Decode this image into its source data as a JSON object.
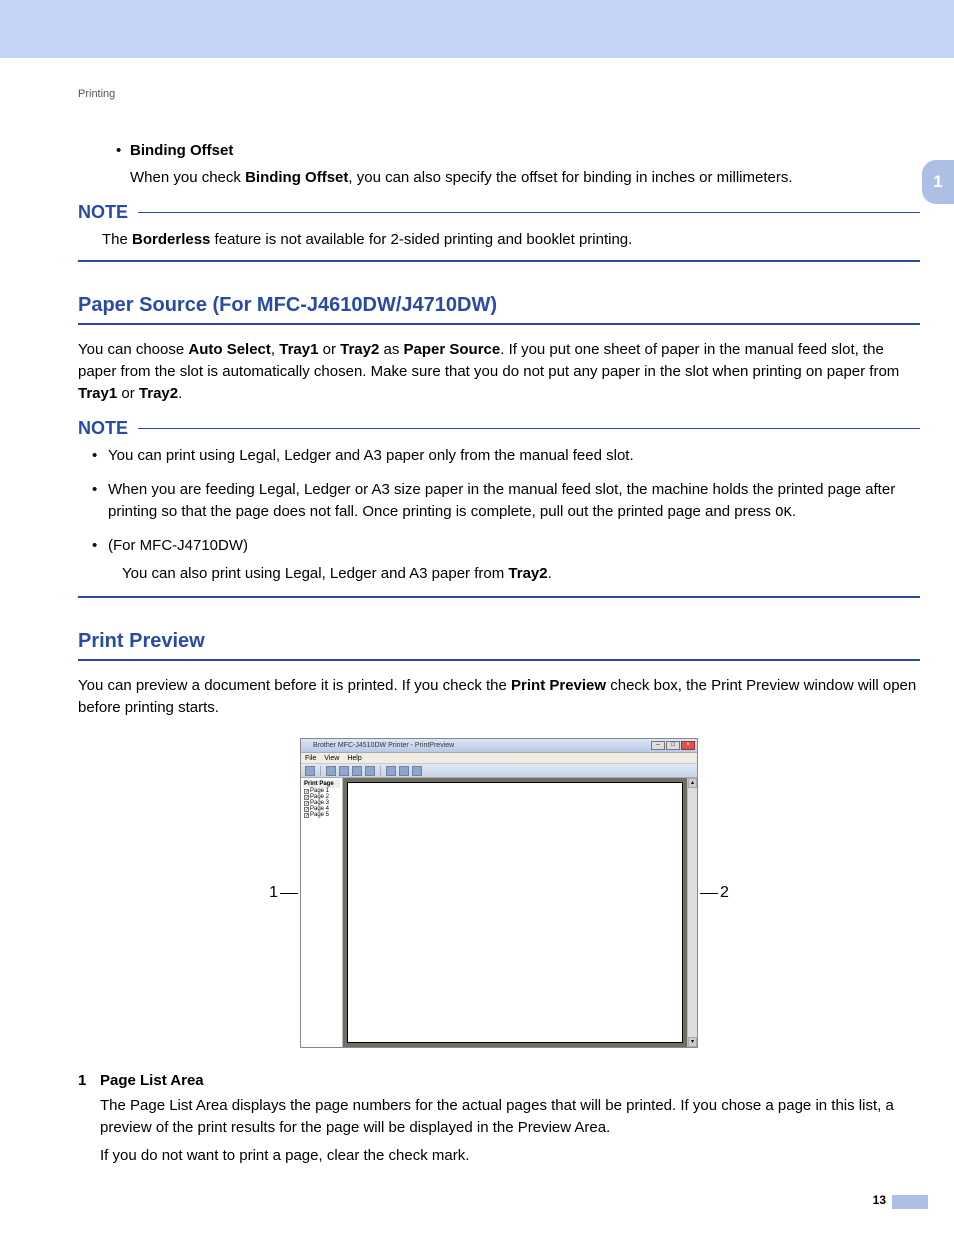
{
  "header": {
    "section": "Printing"
  },
  "side_tab": "1",
  "binding": {
    "title": "Binding Offset",
    "desc_pre": "When you check ",
    "desc_bold": "Binding Offset",
    "desc_post": ", you can also specify the offset for binding in inches or millimeters."
  },
  "note1": {
    "label": "NOTE",
    "t1": "The ",
    "b1": "Borderless",
    "t2": " feature is not available for 2-sided printing and booklet printing."
  },
  "paper_source": {
    "title": "Paper Source (For MFC-J4610DW/J4710DW)",
    "p_a": "You can choose ",
    "p_b1": "Auto Select",
    "p_c": ", ",
    "p_b2": "Tray1",
    "p_d": " or ",
    "p_b3": "Tray2",
    "p_e": " as ",
    "p_b4": "Paper Source",
    "p_f": ". If you put one sheet of paper in the manual feed slot, the paper from the slot is automatically chosen. Make sure that you do not put any paper in the slot when printing on paper from ",
    "p_b5": "Tray1",
    "p_g": " or ",
    "p_b6": "Tray2",
    "p_h": "."
  },
  "note2": {
    "label": "NOTE",
    "li1": "You can print using Legal, Ledger and A3 paper only from the manual feed slot.",
    "li2_a": "When you are feeding Legal, Ledger or A3 size paper in the manual feed slot, the machine holds the printed page after printing so that the page does not fall. Once printing is complete, pull out the printed page and press ",
    "li2_ok": "OK",
    "li2_b": ".",
    "li3": "(For MFC-J4710DW)",
    "li3_sub_a": "You can also print using Legal, Ledger and A3 paper from ",
    "li3_sub_b": "Tray2",
    "li3_sub_c": "."
  },
  "print_preview": {
    "title": "Print Preview",
    "p_a": "You can preview a document before it is printed. If you check the ",
    "p_b": "Print Preview",
    "p_c": " check box, the Print Preview window will open before printing starts."
  },
  "pw": {
    "title": "Brother MFC-J4510DW Printer - PrintPreview",
    "menu": {
      "file": "File",
      "view": "View",
      "help": "Help"
    },
    "side_head": "Print Page",
    "pages": [
      "Page 1",
      "Page 2",
      "Page 3",
      "Page 4",
      "Page 5"
    ]
  },
  "callout": {
    "left": "1",
    "right": "2"
  },
  "numlist": {
    "n1": "1",
    "t1": "Page List Area",
    "d1a": "The Page List Area displays the page numbers for the actual pages that will be printed. If you chose a page in this list, a preview of the print results for the page will be displayed in the Preview Area.",
    "d1b": "If you do not want to print a page, clear the check mark."
  },
  "footer": {
    "page": "13"
  }
}
